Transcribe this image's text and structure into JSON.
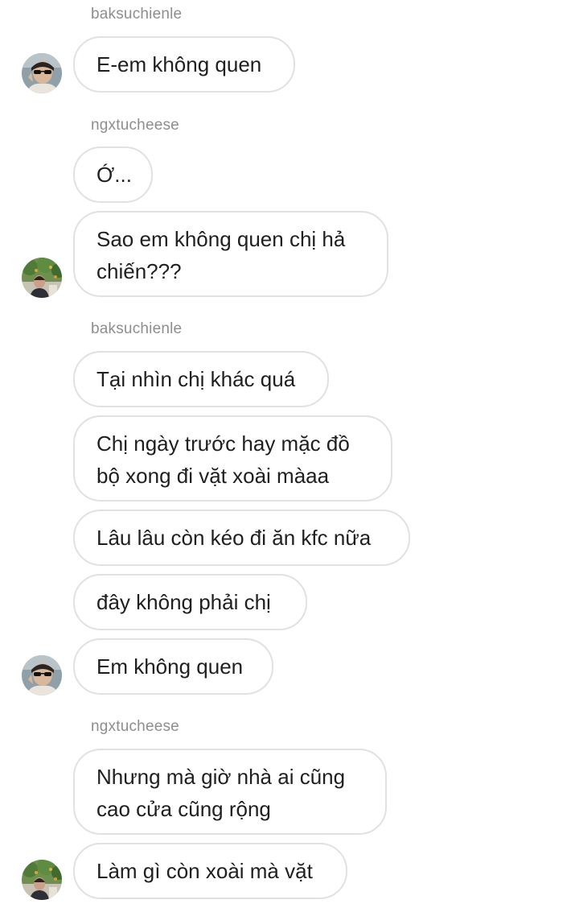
{
  "thread": {
    "senders": [
      "baksuchienle",
      "ngxtucheese",
      "baksuchienle",
      "ngxtucheese"
    ],
    "messages": [
      "E-em không quen",
      "Ớ...",
      "Sao em không quen chị hả chiến???",
      "Tại nhìn chị khác quá",
      "Chị ngày trước hay mặc đồ bộ xong đi vặt xoài màaa",
      "Lâu lâu còn kéo đi ăn kfc nữa",
      "đây không phải chị",
      "Em không quen",
      "Nhưng mà giờ nhà ai cũng cao cửa cũng rộng",
      "Làm gì còn xoài mà vặt"
    ],
    "avatars": [
      "avatar-baksuchienle",
      "avatar-ngxtucheese"
    ]
  }
}
